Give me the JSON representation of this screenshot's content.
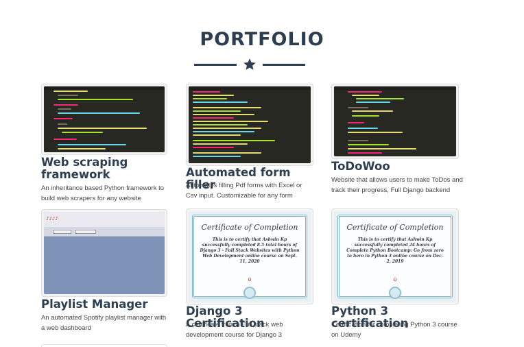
{
  "section": {
    "title": "PORTFOLIO"
  },
  "colors": {
    "heading": "#2c3e50",
    "editor_bg": "#272822",
    "playlist_bg": "#7f93b8",
    "cert_border": "#7fb3c8"
  },
  "icons": {
    "divider": "star-icon"
  },
  "portfolio": [
    {
      "title": "Web scraping framework",
      "description": "An inheritance based Python framework to build web scrapers for any website",
      "thumbnail": "code-editor-screenshot"
    },
    {
      "title": "Automated form filler",
      "description": "Automates filling Pdf forms with Excel or Csv input. Customizable for any form",
      "thumbnail": "code-editor-screenshot"
    },
    {
      "title": "ToDoWoo",
      "description": "Website that allows users to make ToDos and track their progress, Full Django backend",
      "thumbnail": "code-editor-screenshot"
    },
    {
      "title": "Playlist Manager",
      "description": "An automated Spotify playlist manager with a web dashboard",
      "thumbnail": "web-dashboard-screenshot"
    },
    {
      "title": "Django 3 Certification",
      "description": "A certificate from a Full stack web development course for Django 3",
      "thumbnail": "certificate-image",
      "certificate": {
        "heading": "Certificate of Completion",
        "body": "This is to certify that Ashwin Kp successfully completed 8.5 total hours of Django 3 - Full Stack Websites with Python Web Development online course on Sept. 11, 2020"
      }
    },
    {
      "title": "Python 3 certification",
      "description": "Certification for completing Python 3 course on Udemy",
      "thumbnail": "certificate-image",
      "certificate": {
        "heading": "Certificate of Completion",
        "body": "This is to certify that Ashwin Kp successfully completed 24 hours of Complete Python Bootcamp: Go from zero to hero in Python 3 online course on Dec. 2, 2019"
      }
    }
  ]
}
